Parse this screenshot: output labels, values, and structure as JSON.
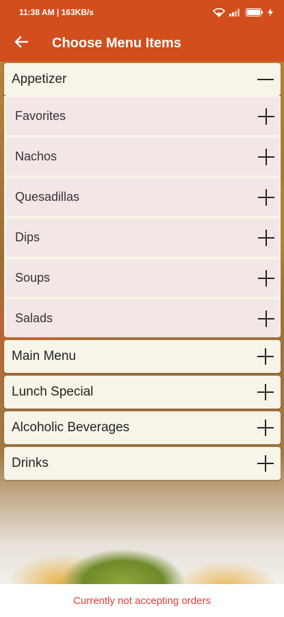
{
  "status_bar": {
    "time_info": "11:38 AM | 163KB/s",
    "battery": "85"
  },
  "app_bar": {
    "title": "Choose Menu Items",
    "accent_color": "#d24e1d"
  },
  "categories": [
    {
      "label": "Appetizer",
      "expanded": true,
      "icon": "minus-icon",
      "items": [
        {
          "label": "Favorites",
          "icon": "plus-icon"
        },
        {
          "label": "Nachos",
          "icon": "plus-icon"
        },
        {
          "label": "Quesadillas",
          "icon": "plus-icon"
        },
        {
          "label": "Dips",
          "icon": "plus-icon"
        },
        {
          "label": "Soups",
          "icon": "plus-icon"
        },
        {
          "label": "Salads",
          "icon": "plus-icon"
        }
      ]
    },
    {
      "label": "Main Menu",
      "expanded": false,
      "icon": "plus-icon"
    },
    {
      "label": "Lunch Special",
      "expanded": false,
      "icon": "plus-icon"
    },
    {
      "label": "Alcoholic Beverages",
      "expanded": false,
      "icon": "plus-icon"
    },
    {
      "label": "Drinks",
      "expanded": false,
      "icon": "plus-icon"
    }
  ],
  "footer": {
    "message": "Currently not accepting orders",
    "message_color": "#e53935"
  }
}
